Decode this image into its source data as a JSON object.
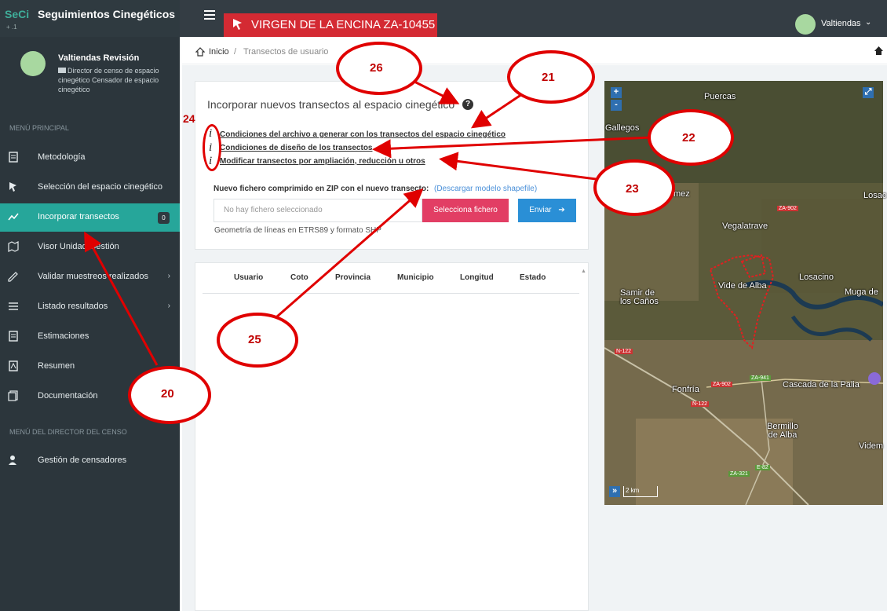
{
  "header": {
    "logo": "SeCi",
    "app_title": "Seguimientos Cinegéticos",
    "brand_sub": "+ .1",
    "coto_title": "VIRGEN DE LA ENCINA ZA-10455",
    "user_name": "Valtiendas",
    "user_chevron": "⌄"
  },
  "sidebar": {
    "user_name": "Valtiendas Revisión",
    "user_role": "Director de censo de espacio cinegético Censador de espacio cinegético",
    "menu_principal": "MENÚ PRINCIPAL",
    "menu_director": "MENÚ DEL DIRECTOR DEL CENSO",
    "items": [
      {
        "label": "Metodología",
        "icon": "document-icon"
      },
      {
        "label": "Selección del espacio cinegético",
        "icon": "pointer-icon"
      },
      {
        "label": "Incorporar transectos",
        "icon": "trend-icon",
        "badge": "0"
      },
      {
        "label": "Visor Unidad Gestión",
        "icon": "map-icon"
      },
      {
        "label": "Validar muestreos realizados",
        "icon": "edit-icon",
        "chevron": "›"
      },
      {
        "label": "Listado resultados",
        "icon": "list-icon",
        "chevron": "›"
      },
      {
        "label": "Estimaciones",
        "icon": "document-icon"
      },
      {
        "label": "Resumen",
        "icon": "pdf-icon"
      },
      {
        "label": "Documentación",
        "icon": "files-icon"
      },
      {
        "label": "Gestión de censadores",
        "icon": "users-icon"
      }
    ]
  },
  "breadcrumb": {
    "home": "Inicio",
    "separator": "/",
    "current": "Transectos de usuario"
  },
  "upload_card": {
    "title": "Incorporar nuevos transectos al espacio cinegético",
    "help": "?",
    "info_links": [
      "Condiciones del archivo a generar con los transectos del espacio cinegético",
      "Condiciones de diseño de los transectos",
      "Modificar transectos por ampliación, reducción u otros"
    ],
    "info_glyph": "i",
    "zip_label": "Nuevo fichero comprimido en ZIP con el nuevo transecto:",
    "zip_link": "(Descargar modelo shapefile)",
    "file_placeholder": "No hay fichero seleccionado",
    "select_button": "Selecciona fichero",
    "send_button": "Enviar",
    "send_arrow": "➔",
    "geometry_note": "Geometría de líneas en ETRS89 y formato SHP"
  },
  "table": {
    "headers": [
      "Usuario",
      "Coto",
      "Provincia",
      "Municipio",
      "Longitud",
      "Estado"
    ]
  },
  "map": {
    "zoom_in": "+",
    "zoom_out": "-",
    "expand": "⤢",
    "scale_button": "»",
    "scale": "2 km",
    "places": [
      "Puercas",
      "Gallegos",
      "mez",
      "Losac",
      "Vegalatrave",
      "Samir de los Caños",
      "Vide de Alba",
      "Losacino",
      "Muga de",
      "Fonfría",
      "Cascada de la Palia",
      "Bermillo de Alba",
      "Videm"
    ],
    "roads": [
      "ZA-902",
      "N-122",
      "ZA-941",
      "ZA-902",
      "N-122",
      "E-82",
      "ZA-321"
    ]
  },
  "annotations": [
    "20",
    "21",
    "22",
    "23",
    "24",
    "25",
    "26"
  ],
  "colors": {
    "sidebar_bg": "#2c363c",
    "active_item": "#26a69a",
    "coto_red": "#d42a33",
    "select_pink": "#e23e64",
    "send_blue": "#2a8fd6",
    "annotation_red": "#e00000"
  }
}
